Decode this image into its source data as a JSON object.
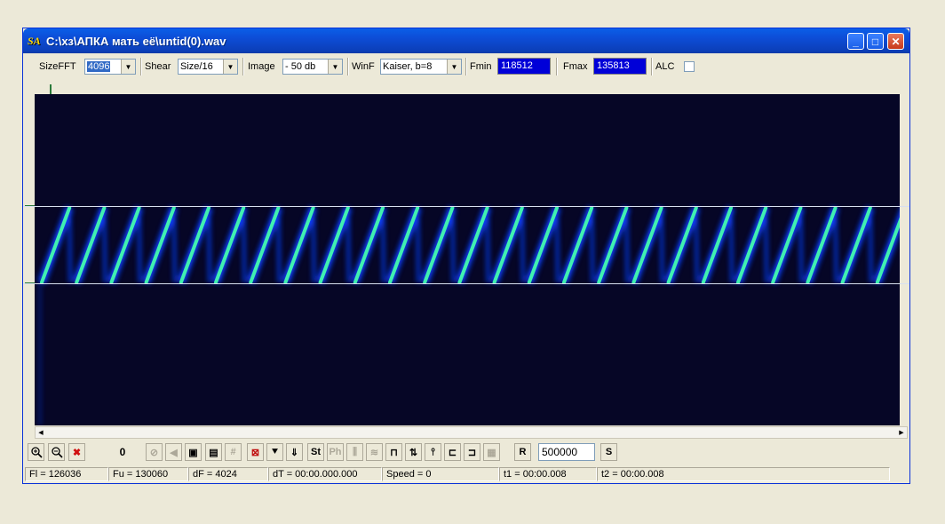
{
  "window": {
    "title": "C:\\хз\\АПКА мать её\\untid(0).wav",
    "app_icon": "SA",
    "buttons": {
      "minimize": "_",
      "maximize": "□",
      "close": "✕"
    }
  },
  "toolbar": {
    "sizefft_label": "SizeFFT",
    "sizefft_value": "4096",
    "shear_label": "Shear",
    "shear_value": "Size/16",
    "image_label": "Image",
    "image_value": "- 50 db",
    "winf_label": "WinF",
    "winf_value": "Kaiser, b=8",
    "fmin_label": "Fmin",
    "fmin_value": "118512",
    "fmax_label": "Fmax",
    "fmax_value": "135813",
    "alc_label": "ALC"
  },
  "spectrogram": {
    "sweeps": 24,
    "colors": {
      "background": "#060626",
      "trace": "#40f0b0",
      "glow": "#1040ff"
    }
  },
  "buttons": {
    "counter": "0",
    "st_label": "St",
    "ph_label": "Ph",
    "r_label": "R",
    "r_value": "500000",
    "s_label": "S"
  },
  "status": {
    "fl": "Fl = 126036",
    "fu": "Fu = 130060",
    "df": "dF = 4024",
    "dt": "dT = 00:00.000.000",
    "speed": "Speed = 0",
    "t1": "t1 = 00:00.008",
    "t2": "t2 = 00:00.008"
  }
}
